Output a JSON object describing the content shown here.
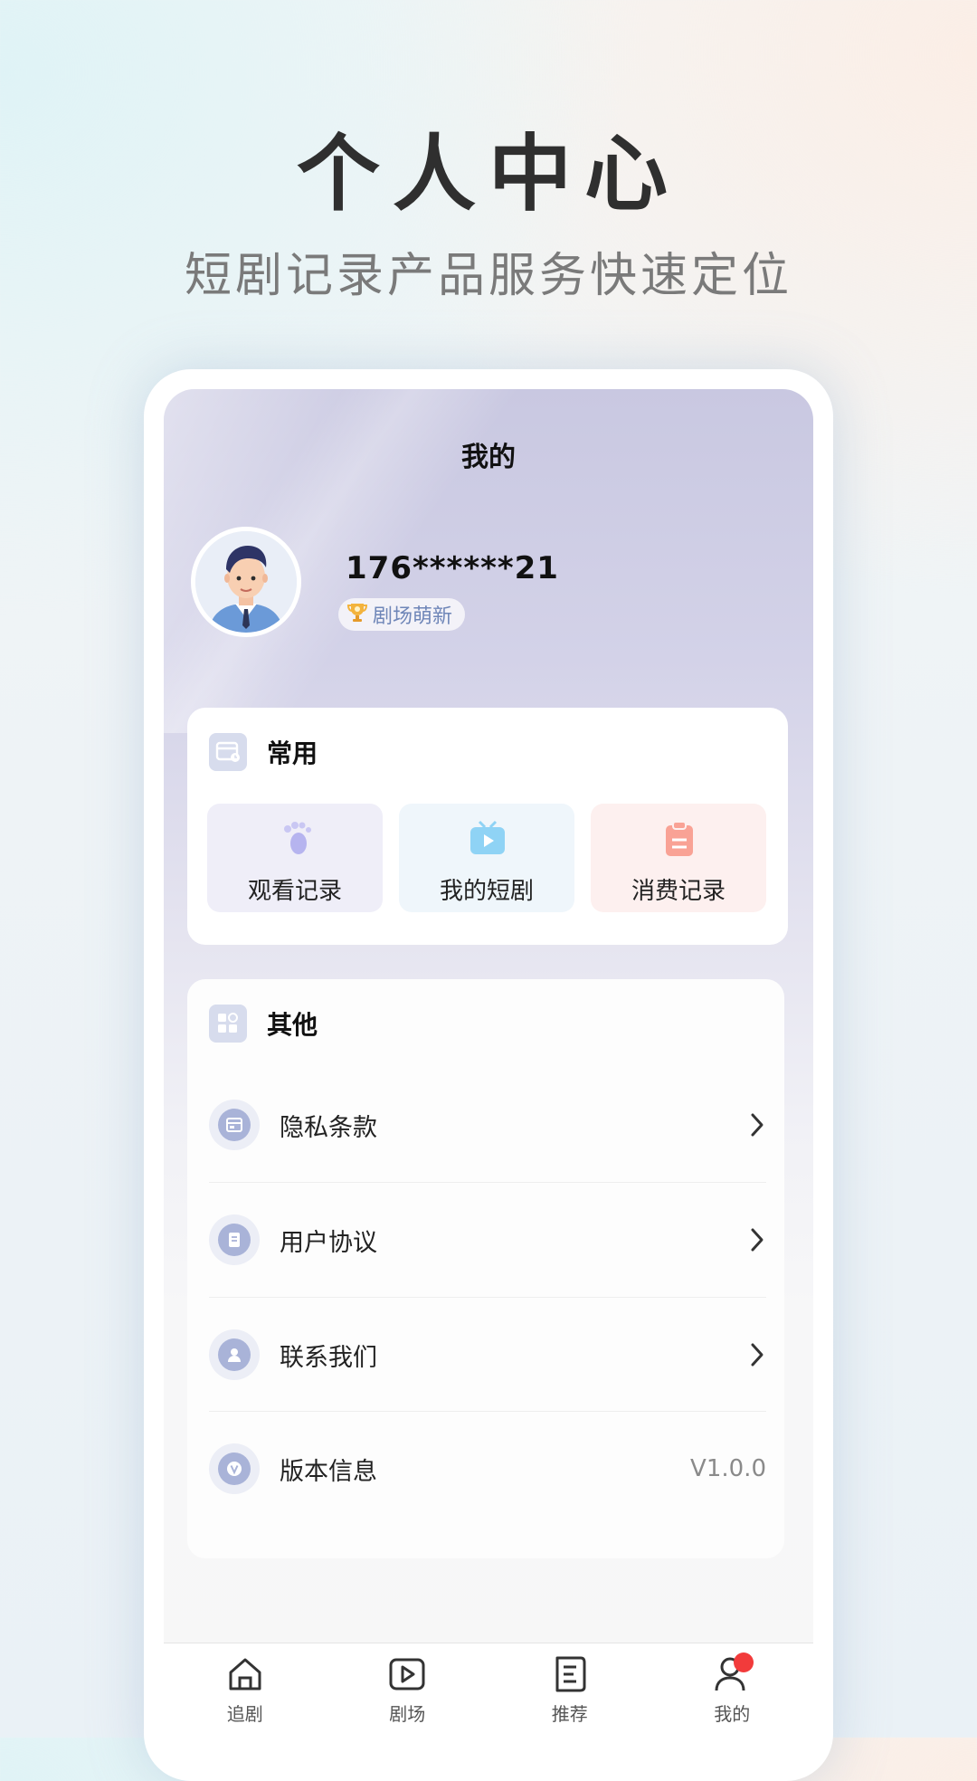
{
  "promo": {
    "title": "个人中心",
    "subtitle": "短剧记录产品服务快速定位"
  },
  "screen": {
    "title": "我的"
  },
  "profile": {
    "phone": "176******21",
    "level_badge": "剧场萌新",
    "level_icon": "trophy-icon"
  },
  "common": {
    "title": "常用",
    "items": [
      {
        "label": "观看记录",
        "icon": "footprint-icon",
        "color": "#b6b4ef"
      },
      {
        "label": "我的短剧",
        "icon": "tv-play-icon",
        "color": "#8fd3f5"
      },
      {
        "label": "消费记录",
        "icon": "clipboard-icon",
        "color": "#f9a295"
      }
    ]
  },
  "other": {
    "title": "其他",
    "items": [
      {
        "label": "隐私条款",
        "icon": "privacy-icon"
      },
      {
        "label": "用户协议",
        "icon": "document-icon"
      },
      {
        "label": "联系我们",
        "icon": "contact-icon"
      },
      {
        "label": "版本信息",
        "icon": "version-icon",
        "value": "V1.0.0"
      }
    ]
  },
  "tabbar": {
    "items": [
      {
        "label": "追剧",
        "icon": "home-icon"
      },
      {
        "label": "剧场",
        "icon": "play-icon"
      },
      {
        "label": "推荐",
        "icon": "recommend-icon"
      },
      {
        "label": "我的",
        "icon": "profile-icon",
        "active": true
      }
    ]
  },
  "colors": {
    "accent_red": "#f23b3b",
    "menu_icon": "#a9b3d8",
    "badge_text": "#6f86b8"
  }
}
